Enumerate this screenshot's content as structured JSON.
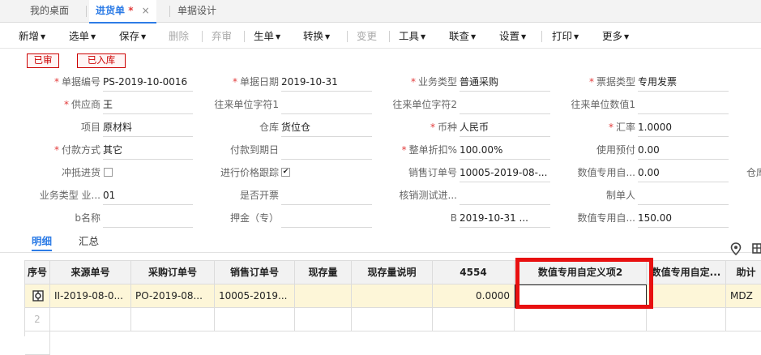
{
  "tabs": [
    {
      "label": "我的桌面",
      "active": false
    },
    {
      "label": "进货单",
      "active": true,
      "modified_mark": "*",
      "close": "×"
    },
    {
      "label": "单据设计",
      "active": false
    }
  ],
  "toolbar": {
    "new": "新增",
    "select": "选单",
    "save": "保存",
    "delete": "删除",
    "abandon": "弃审",
    "generate": "生单",
    "convert": "转换",
    "change": "变更",
    "tools": "工具",
    "query": "联查",
    "settings": "设置",
    "print": "打印",
    "more": "更多"
  },
  "status_tags": [
    "已审",
    "已入库"
  ],
  "form": {
    "doc_no": {
      "label": "单据编号",
      "value": "PS-2019-10-0016"
    },
    "doc_date": {
      "label": "单据日期",
      "value": "2019-10-31"
    },
    "biz_type": {
      "label": "业务类型",
      "value": "普通采购"
    },
    "invoice_type": {
      "label": "票据类型",
      "value": "专用发票"
    },
    "supplier": {
      "label": "供应商",
      "value": "王"
    },
    "partner_str1": {
      "label": "往来单位字符1",
      "value": ""
    },
    "partner_str2": {
      "label": "往来单位字符2",
      "value": ""
    },
    "partner_num1": {
      "label": "往来单位数值1",
      "value": ""
    },
    "project": {
      "label": "项目",
      "value": "原材料"
    },
    "warehouse": {
      "label": "仓库",
      "value": "货位仓"
    },
    "currency": {
      "label": "币种",
      "value": "人民币"
    },
    "rate": {
      "label": "汇率",
      "value": "1.0000"
    },
    "pay_method": {
      "label": "付款方式",
      "value": "其它"
    },
    "pay_due": {
      "label": "付款到期日",
      "value": ""
    },
    "discount": {
      "label": "整单折扣%",
      "value": "100.00%"
    },
    "prepay": {
      "label": "使用预付",
      "value": "0.00"
    },
    "offset": {
      "label": "冲抵进货",
      "checked": false
    },
    "price_track": {
      "label": "进行价格跟踪",
      "checked": true
    },
    "sales_order": {
      "label": "销售订单号",
      "value": "10005-2019-08-..."
    },
    "num_custom1": {
      "label": "数值专用自...",
      "value": "0.00"
    },
    "warehouse_cut": {
      "label": "仓库"
    },
    "biz_type2": {
      "label": "业务类型 业...",
      "value": "01"
    },
    "open_ticket": {
      "label": "是否开票",
      "value": ""
    },
    "verify_test": {
      "label": "核销测试进...",
      "value": ""
    },
    "maker": {
      "label": "制单人",
      "value": ""
    },
    "b_name": {
      "label": "b名称",
      "value": ""
    },
    "deposit": {
      "label": "押金（专）",
      "value": ""
    },
    "b_field": {
      "label": "B",
      "value": "2019-10-31 ..."
    },
    "num_custom2": {
      "label": "数值专用自...",
      "value": "150.00"
    }
  },
  "detail_tabs": [
    "明细",
    "汇总"
  ],
  "grid": {
    "headers": [
      "序号",
      "来源单号",
      "采购订单号",
      "销售订单号",
      "现存量",
      "现存量说明",
      "4554",
      "数值专用自定义项2",
      "数值专用自定...",
      "助计"
    ],
    "rows": [
      {
        "no": "",
        "source": "II-2019-08-0...",
        "po": "PO-2019-08...",
        "so": "10005-2019...",
        "stock": "",
        "stock_note": "",
        "n4554": "0.0000",
        "custom2": "",
        "custom_x": "",
        "aux": "MDZ"
      },
      {
        "no": "2",
        "source": "",
        "po": "",
        "so": "",
        "stock": "",
        "stock_note": "",
        "n4554": "",
        "custom2": "",
        "custom_x": "",
        "aux": ""
      }
    ]
  },
  "icons": {
    "row_settings": "gear-icon",
    "location": "location-pin-icon",
    "grid_tool": "grid-settings-icon"
  }
}
